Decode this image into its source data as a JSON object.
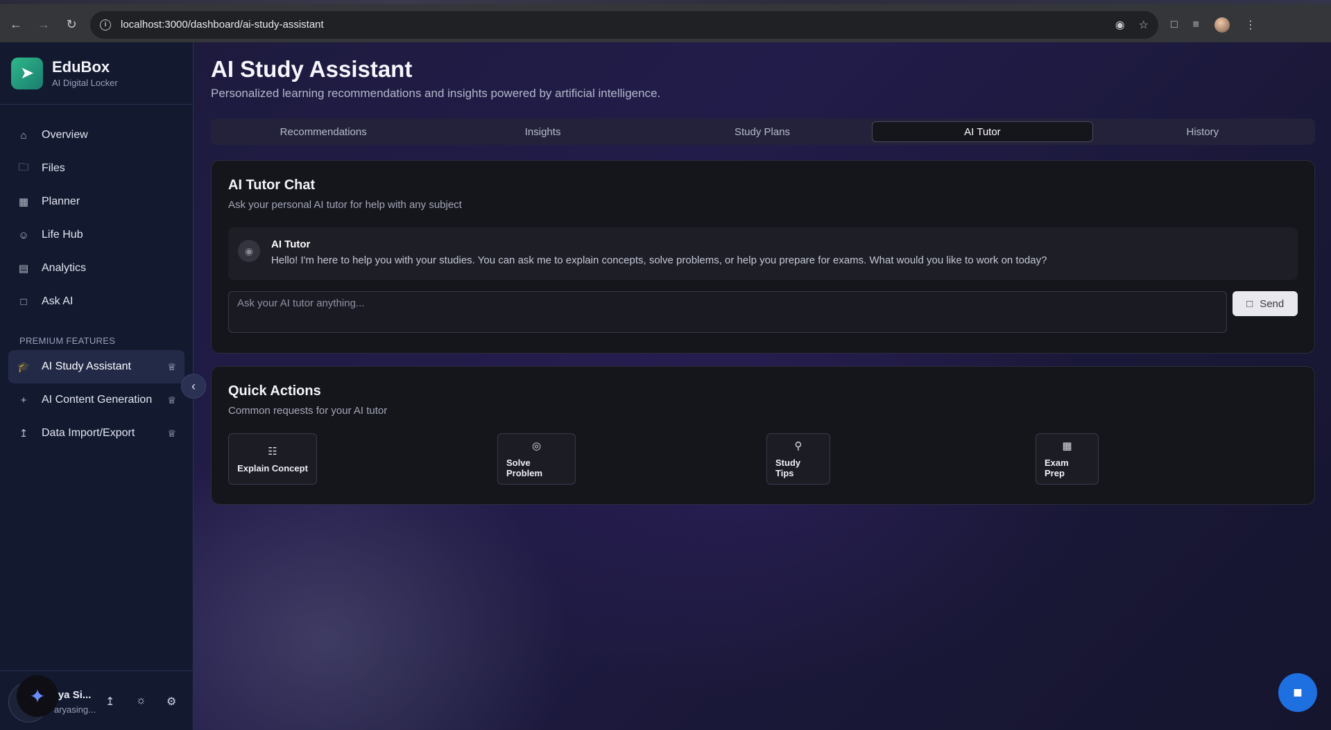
{
  "browser": {
    "url": "localhost:3000/dashboard/ai-study-assistant"
  },
  "sidebar": {
    "brand_name": "EduBox",
    "brand_sub": "AI Digital Locker",
    "items": [
      {
        "label": "Overview",
        "icon": "home-icon"
      },
      {
        "label": "Files",
        "icon": "folder-icon"
      },
      {
        "label": "Planner",
        "icon": "calendar-icon"
      },
      {
        "label": "Life Hub",
        "icon": "users-icon"
      },
      {
        "label": "Analytics",
        "icon": "bar-chart-icon"
      },
      {
        "label": "Ask AI",
        "icon": "message-icon"
      }
    ],
    "premium_label": "PREMIUM FEATURES",
    "premium_items": [
      {
        "label": "AI Study Assistant",
        "icon": "graduation-cap-icon",
        "active": true
      },
      {
        "label": "AI Content Generation",
        "icon": "plus-icon"
      },
      {
        "label": "Data Import/Export",
        "icon": "upload-icon"
      }
    ],
    "user": {
      "name": "rya Si...",
      "email": "aryasing..."
    }
  },
  "main": {
    "title": "AI Study Assistant",
    "subtitle": "Personalized learning recommendations and insights powered by artificial intelligence.",
    "tabs": [
      {
        "label": "Recommendations"
      },
      {
        "label": "Insights"
      },
      {
        "label": "Study Plans"
      },
      {
        "label": "AI Tutor",
        "active": true
      },
      {
        "label": "History"
      }
    ],
    "chat": {
      "title": "AI Tutor Chat",
      "subtitle": "Ask your personal AI tutor for help with any subject",
      "message_author": "AI Tutor",
      "message_text": "Hello! I'm here to help you with your studies. You can ask me to explain concepts, solve problems, or help you prepare for exams. What would you like to work on today?",
      "input_placeholder": "Ask your AI tutor anything...",
      "send_label": "Send"
    },
    "quick_actions": {
      "title": "Quick Actions",
      "subtitle": "Common requests for your AI tutor",
      "actions": [
        {
          "label": "Explain Concept",
          "icon": "book-icon"
        },
        {
          "label": "Solve Problem",
          "icon": "target-icon"
        },
        {
          "label": "Study Tips",
          "icon": "lightbulb-icon"
        },
        {
          "label": "Exam Prep",
          "icon": "calendar-icon"
        }
      ]
    }
  },
  "colors": {
    "accent": "#1e6fe0",
    "sidebar_bg": "#131a30",
    "card_bg": "#15151c"
  }
}
